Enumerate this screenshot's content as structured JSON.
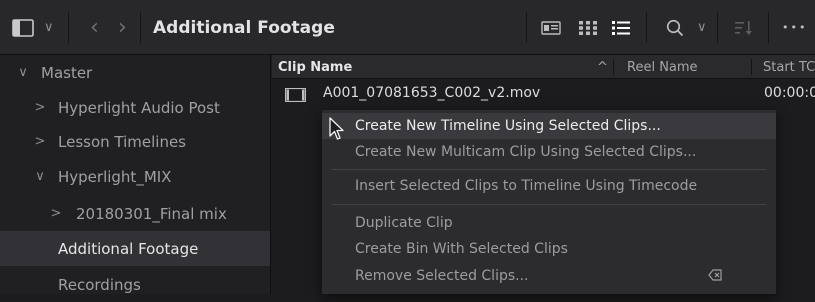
{
  "toolbar": {
    "title": "Additional Footage",
    "dropdown_glyph": "∨",
    "back_glyph": "‹",
    "forward_glyph": "›",
    "more_glyph": "•••"
  },
  "icons": {
    "sidebar_toggle": "panel-toggle-icon",
    "metadata_view": "metadata-view-icon",
    "thumbnail_view": "thumbnail-view-icon",
    "list_view": "list-view-icon",
    "search": "search-icon",
    "sort": "sort-icon",
    "more": "more-options-icon",
    "film": "film-clip-icon",
    "cursor": "mouse-cursor-icon",
    "remove": "delete-key-icon"
  },
  "sidebar": {
    "items": [
      {
        "label": "Master",
        "chevron": "∨"
      },
      {
        "label": "Hyperlight Audio Post",
        "chevron": ">"
      },
      {
        "label": "Lesson Timelines",
        "chevron": ">"
      },
      {
        "label": "Hyperlight_MIX",
        "chevron": "∨"
      },
      {
        "label": "20180301_Final mix",
        "chevron": ">"
      },
      {
        "label": "Additional Footage",
        "chevron": ""
      },
      {
        "label": "Recordings",
        "chevron": ""
      }
    ]
  },
  "columns": {
    "clip_name": "Clip Name",
    "sort_glyph": "^",
    "reel_name": "Reel Name",
    "start_tc": "Start TC"
  },
  "clip": {
    "name": "A001_07081653_C002_v2.mov",
    "start_tc": "00:00:0"
  },
  "context_menu": {
    "items": [
      "Create New Timeline Using Selected Clips...",
      "Create New Multicam Clip Using Selected Clips...",
      "Insert Selected Clips to Timeline Using Timecode",
      "Duplicate Clip",
      "Create Bin With Selected Clips",
      "Remove Selected Clips..."
    ]
  },
  "colors": {
    "toolbar_bg": "#28282b",
    "sidebar_bg": "#202023",
    "selected_bg": "#323236",
    "menu_bg": "#2c2c2f",
    "accent_icon": "#dcdcde"
  }
}
